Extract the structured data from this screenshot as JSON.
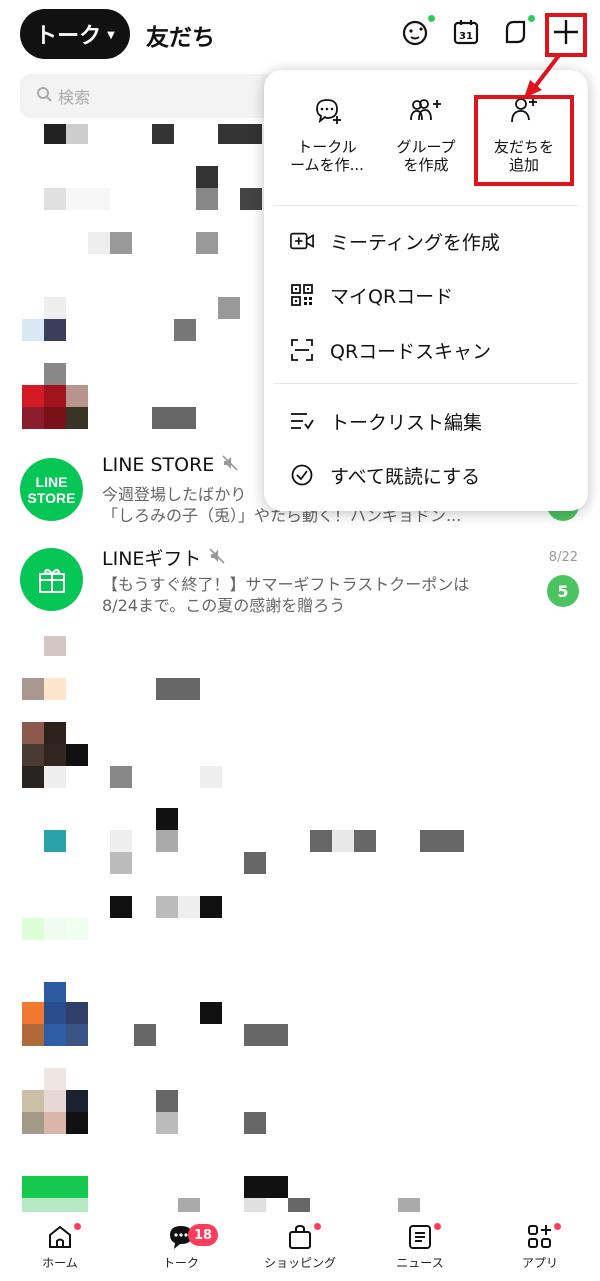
{
  "header": {
    "active_tab": "トーク",
    "other_tab": "友だち"
  },
  "search": {
    "placeholder": "検索"
  },
  "chats": [
    {
      "name": "LINE STORE",
      "avatar_text": "LINE\nSTORE",
      "muted": true,
      "line1": "今週登場したばかり",
      "line2": "「しろみの子（兎）」やたら動く！ハンギョドン...",
      "time": "",
      "badge": ""
    },
    {
      "name": "LINEギフト",
      "muted": true,
      "line1": "【もうすぐ終了！】サマーギフトラストクーポンは",
      "line2": "8/24まで。この夏の感謝を贈ろう",
      "time": "8/22",
      "badge": "5"
    }
  ],
  "menu": {
    "quick_actions": [
      {
        "icon": "chat-plus-icon",
        "label1": "トークル",
        "label2": "ームを作..."
      },
      {
        "icon": "group-plus-icon",
        "label1": "グループ",
        "label2": "を作成"
      },
      {
        "icon": "friend-plus-icon",
        "label1": "友だちを",
        "label2": "追加"
      }
    ],
    "items": [
      {
        "icon": "video-plus-icon",
        "label": "ミーティングを作成"
      },
      {
        "icon": "qr-code-icon",
        "label": "マイQRコード"
      },
      {
        "icon": "qr-scan-icon",
        "label": "QRコードスキャン"
      },
      {
        "icon": "edit-list-icon",
        "label": "トークリスト編集"
      },
      {
        "icon": "check-circle-icon",
        "label": "すべて既読にする"
      }
    ]
  },
  "bottom_nav": [
    {
      "label": "ホーム",
      "icon": "home-icon"
    },
    {
      "label": "トーク",
      "icon": "chat-icon",
      "badge": "18"
    },
    {
      "label": "ショッピング",
      "icon": "shopping-bag-icon"
    },
    {
      "label": "ニュース",
      "icon": "news-icon"
    },
    {
      "label": "アプリ",
      "icon": "apps-icon"
    }
  ],
  "colors": {
    "line_green": "#06c755",
    "badge_green": "#4cc361",
    "highlight_red": "#e0121b",
    "notif_red": "#ff3d5a"
  }
}
